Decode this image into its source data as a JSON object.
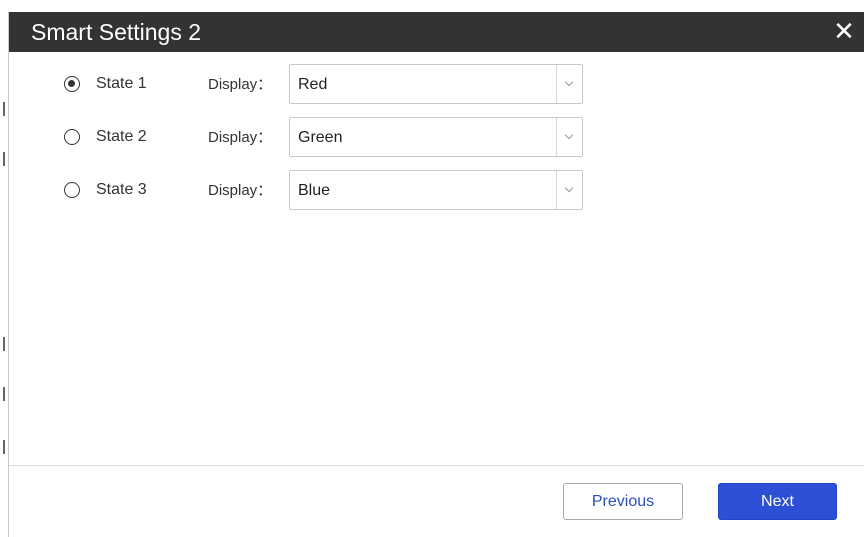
{
  "dialog": {
    "title": "Smart Settings 2",
    "close_icon": "close-icon"
  },
  "states": [
    {
      "label": "State 1",
      "display_label": "Display：",
      "value": "Red",
      "selected": true
    },
    {
      "label": "State 2",
      "display_label": "Display：",
      "value": "Green",
      "selected": false
    },
    {
      "label": "State 3",
      "display_label": "Display：",
      "value": "Blue",
      "selected": false
    }
  ],
  "footer": {
    "previous_label": "Previous",
    "next_label": "Next"
  },
  "colors": {
    "title_bar": "#333333",
    "primary_button": "#2c4fd6",
    "secondary_button_text": "#2a4fb7"
  }
}
